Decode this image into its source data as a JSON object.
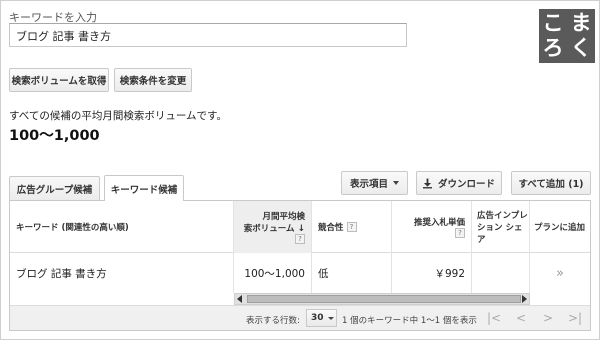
{
  "search": {
    "label": "キーワードを入力",
    "value": "ブログ 記事 書き方"
  },
  "logo": {
    "chars_row1": [
      "こ",
      "ま"
    ],
    "chars_row2": [
      "ろ",
      "く"
    ],
    "bg_color": "#5a5a5a"
  },
  "actions": {
    "get_volume": "検索ボリュームを取得",
    "change_conditions": "検索条件を変更"
  },
  "summary": {
    "description": "すべての候補の平均月間検索ボリュームです。",
    "value": "100〜1,000"
  },
  "tabs": [
    {
      "label": "広告グループ候補",
      "active": false
    },
    {
      "label": "キーワード候補",
      "active": true
    }
  ],
  "toolbar": {
    "display_items": "表示項目",
    "download": "ダウンロード",
    "add_all": "すべて追加 (1)",
    "icons": {
      "display": "chevron-down-icon",
      "download": "download-icon"
    }
  },
  "table": {
    "columns": {
      "keyword": "キーワード (関連性の高い順)",
      "volume_line1": "月間平均検",
      "volume_line2": "索ボリューム",
      "volume_sort": "↓",
      "competition": "競合性",
      "bid": "推奨入札単価",
      "share_line1": "広告インプレ",
      "share_line2": "ション シェア",
      "plan": "プランに追加",
      "help": "?"
    },
    "rows": [
      {
        "keyword": "ブログ 記事 書き方",
        "volume": "100〜1,000",
        "competition": "低",
        "bid": "￥992",
        "share": "",
        "add": "»"
      }
    ]
  },
  "footer": {
    "rows_label": "表示する行数:",
    "rows_value": "30",
    "range_text": "1 個のキーワード中 1〜1 個を表示",
    "pager": [
      "|<",
      "<",
      ">",
      ">|"
    ]
  }
}
